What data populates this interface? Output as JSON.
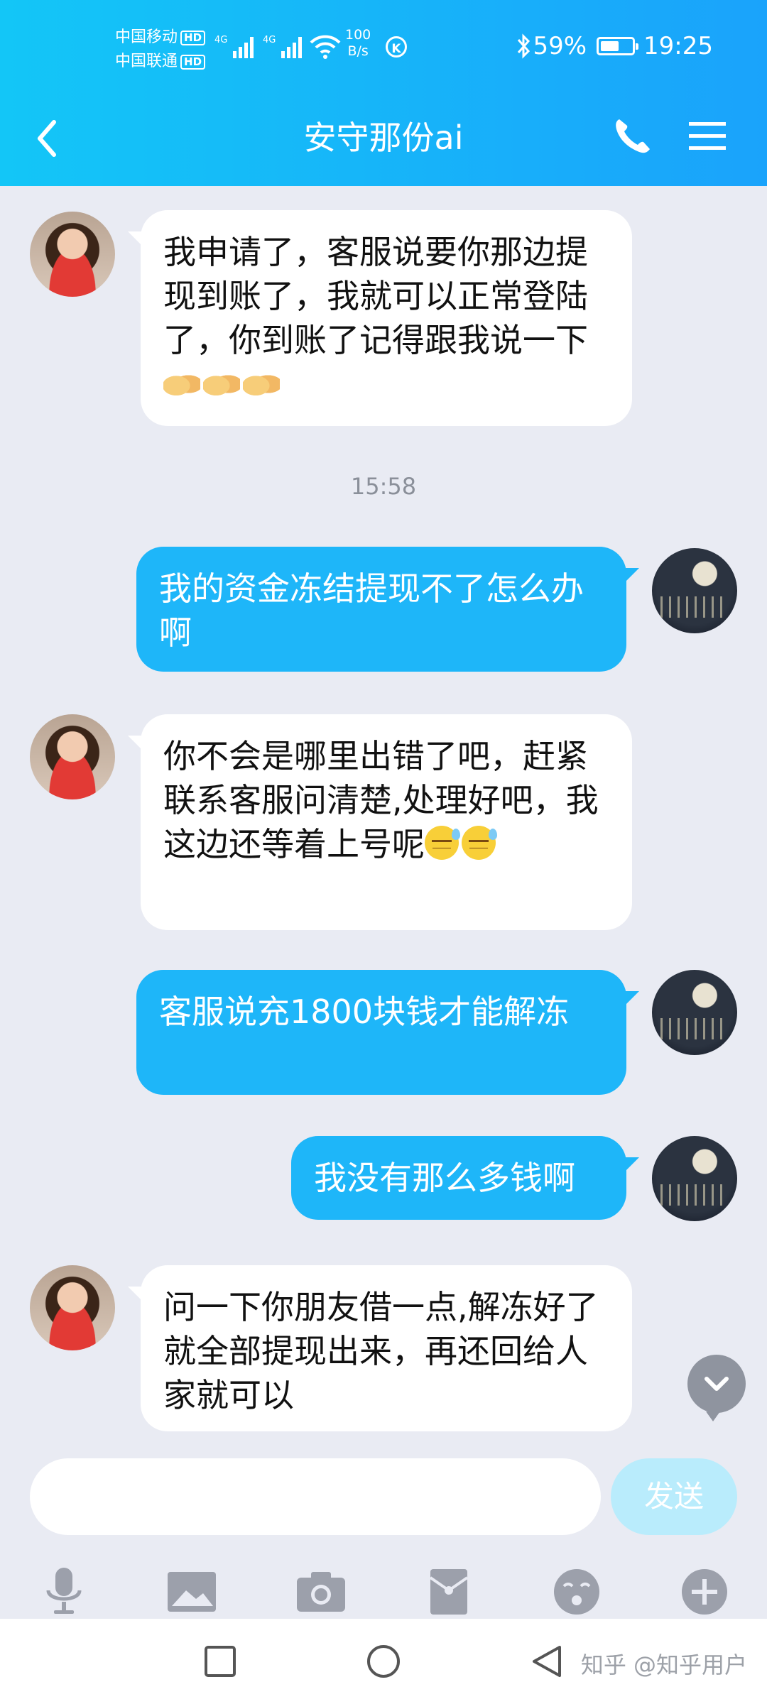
{
  "status_bar": {
    "carrier1": "中国移动",
    "carrier2": "中国联通",
    "hd_label": "HD",
    "net_type": "4G",
    "speed_value": "100",
    "speed_unit": "B/s",
    "k_icon_label": "K",
    "battery_percent": "59%",
    "battery_level": 0.59,
    "time": "19:25"
  },
  "header": {
    "title": "安守那份ai",
    "icons": [
      "back-icon",
      "phone-icon",
      "menu-icon"
    ],
    "color_start": "#13c6f7",
    "color_end": "#1aa3fb"
  },
  "messages": [
    {
      "side": "in",
      "text": "我申请了，客服说要你那边提现到账了，我就可以正常登陆了，你到账了记得跟我说一下",
      "emoji": [
        "handshake",
        "handshake",
        "handshake"
      ]
    },
    {
      "side": "time",
      "text": "15:58"
    },
    {
      "side": "out",
      "text": "我的资金冻结提现不了怎么办啊"
    },
    {
      "side": "in",
      "text": "你不会是哪里出错了吧，赶紧联系客服问清楚,处理好吧，我这边还等着上号呢",
      "emoji": [
        "sweat",
        "sweat"
      ]
    },
    {
      "side": "out",
      "text": "客服说充1800块钱才能解冻"
    },
    {
      "side": "out",
      "text": "我没有那么多钱啊"
    },
    {
      "side": "in",
      "text": "问一下你朋友借一点,解冻好了就全部提现出来，再还回给人家就可以"
    }
  ],
  "input": {
    "placeholder": "",
    "send_label": "发送"
  },
  "toolbar": {
    "icons": [
      "microphone-icon",
      "image-icon",
      "camera-icon",
      "red-packet-icon",
      "emoji-icon",
      "plus-icon"
    ]
  },
  "system_nav": {
    "icons": [
      "recent-apps-icon",
      "home-icon",
      "back-triangle-icon"
    ],
    "watermark": "知乎 @知乎用户"
  },
  "colors": {
    "outgoing_bubble": "#1eb6f9",
    "incoming_bubble": "#ffffff",
    "chat_bg": "#e9ebf3"
  }
}
